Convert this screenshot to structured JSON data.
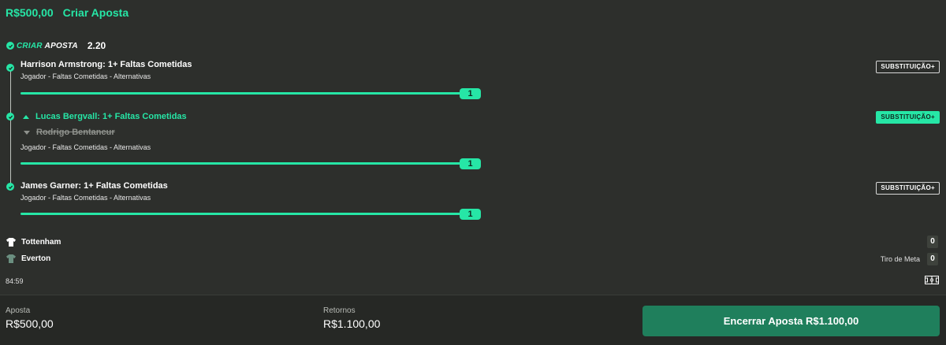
{
  "header": {
    "stake": "R$500,00",
    "title": "Criar Aposta"
  },
  "bet_builder": {
    "label_criar": "CRIAR",
    "label_aposta": "APOSTA",
    "odds": "2.20"
  },
  "legs": [
    {
      "title": "Harrison Armstrong: 1+ Faltas Cometidas",
      "market": "Jogador - Faltas Cometidas - Alternativas",
      "progress_value": "1",
      "progress": 1.0,
      "substitution_label": "SUBSTITUIÇÃO+",
      "highlighted": false
    },
    {
      "title": "Lucas Bergvall: 1+ Faltas Cometidas",
      "replaced_player": "Rodrigo Bentancur",
      "market": "Jogador - Faltas Cometidas - Alternativas",
      "progress_value": "1",
      "progress": 1.0,
      "substitution_label": "SUBSTITUIÇÃO+",
      "highlighted": true
    },
    {
      "title": "James Garner: 1+ Faltas Cometidas",
      "market": "Jogador - Faltas Cometidas - Alternativas",
      "progress_value": "1",
      "progress": 1.0,
      "substitution_label": "SUBSTITUIÇÃO+",
      "highlighted": false
    }
  ],
  "match": {
    "home": {
      "name": "Tottenham",
      "score": "0"
    },
    "away": {
      "name": "Everton",
      "score": "0"
    },
    "last_event": "Tiro de Meta",
    "clock": "84:59"
  },
  "footer": {
    "stake_label": "Aposta",
    "stake_value": "R$500,00",
    "returns_label": "Retornos",
    "returns_value": "R$1.100,00",
    "cashout_button": "Encerrar Aposta R$1.100,00"
  },
  "colors": {
    "accent": "#26e6a6",
    "cashout": "#1f7f5c",
    "background": "#2d2f2c"
  }
}
